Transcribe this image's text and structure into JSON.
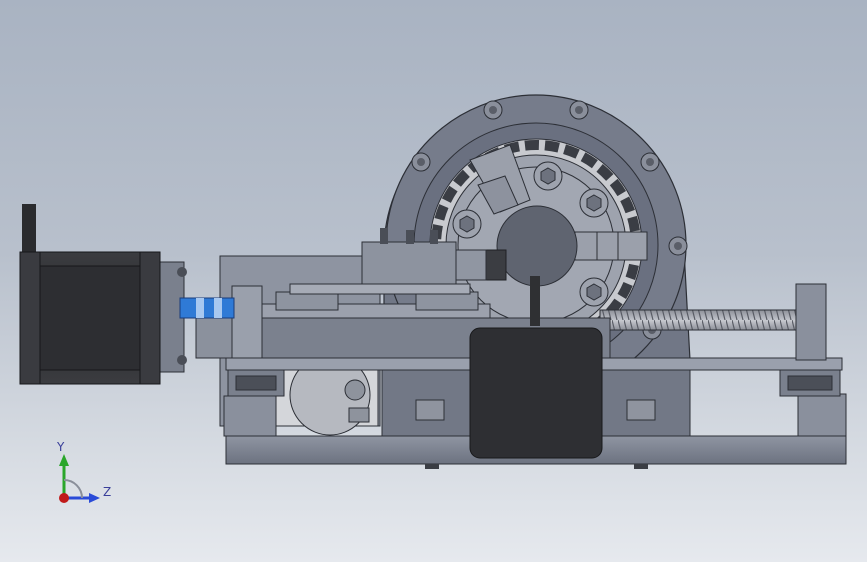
{
  "triad": {
    "y_label": "Y",
    "z_label": "Z",
    "y_color": "#2aa62a",
    "z_color": "#2a4bd8",
    "origin_color": "#c01a1a"
  },
  "colors": {
    "body_gray": "#6d7281",
    "body_light": "#9097a5",
    "motor_dark": "#2f3033",
    "coupler_blue": "#2f7ad6",
    "background_top": "#a9b3c2",
    "background_bottom": "#e6e9ee"
  }
}
